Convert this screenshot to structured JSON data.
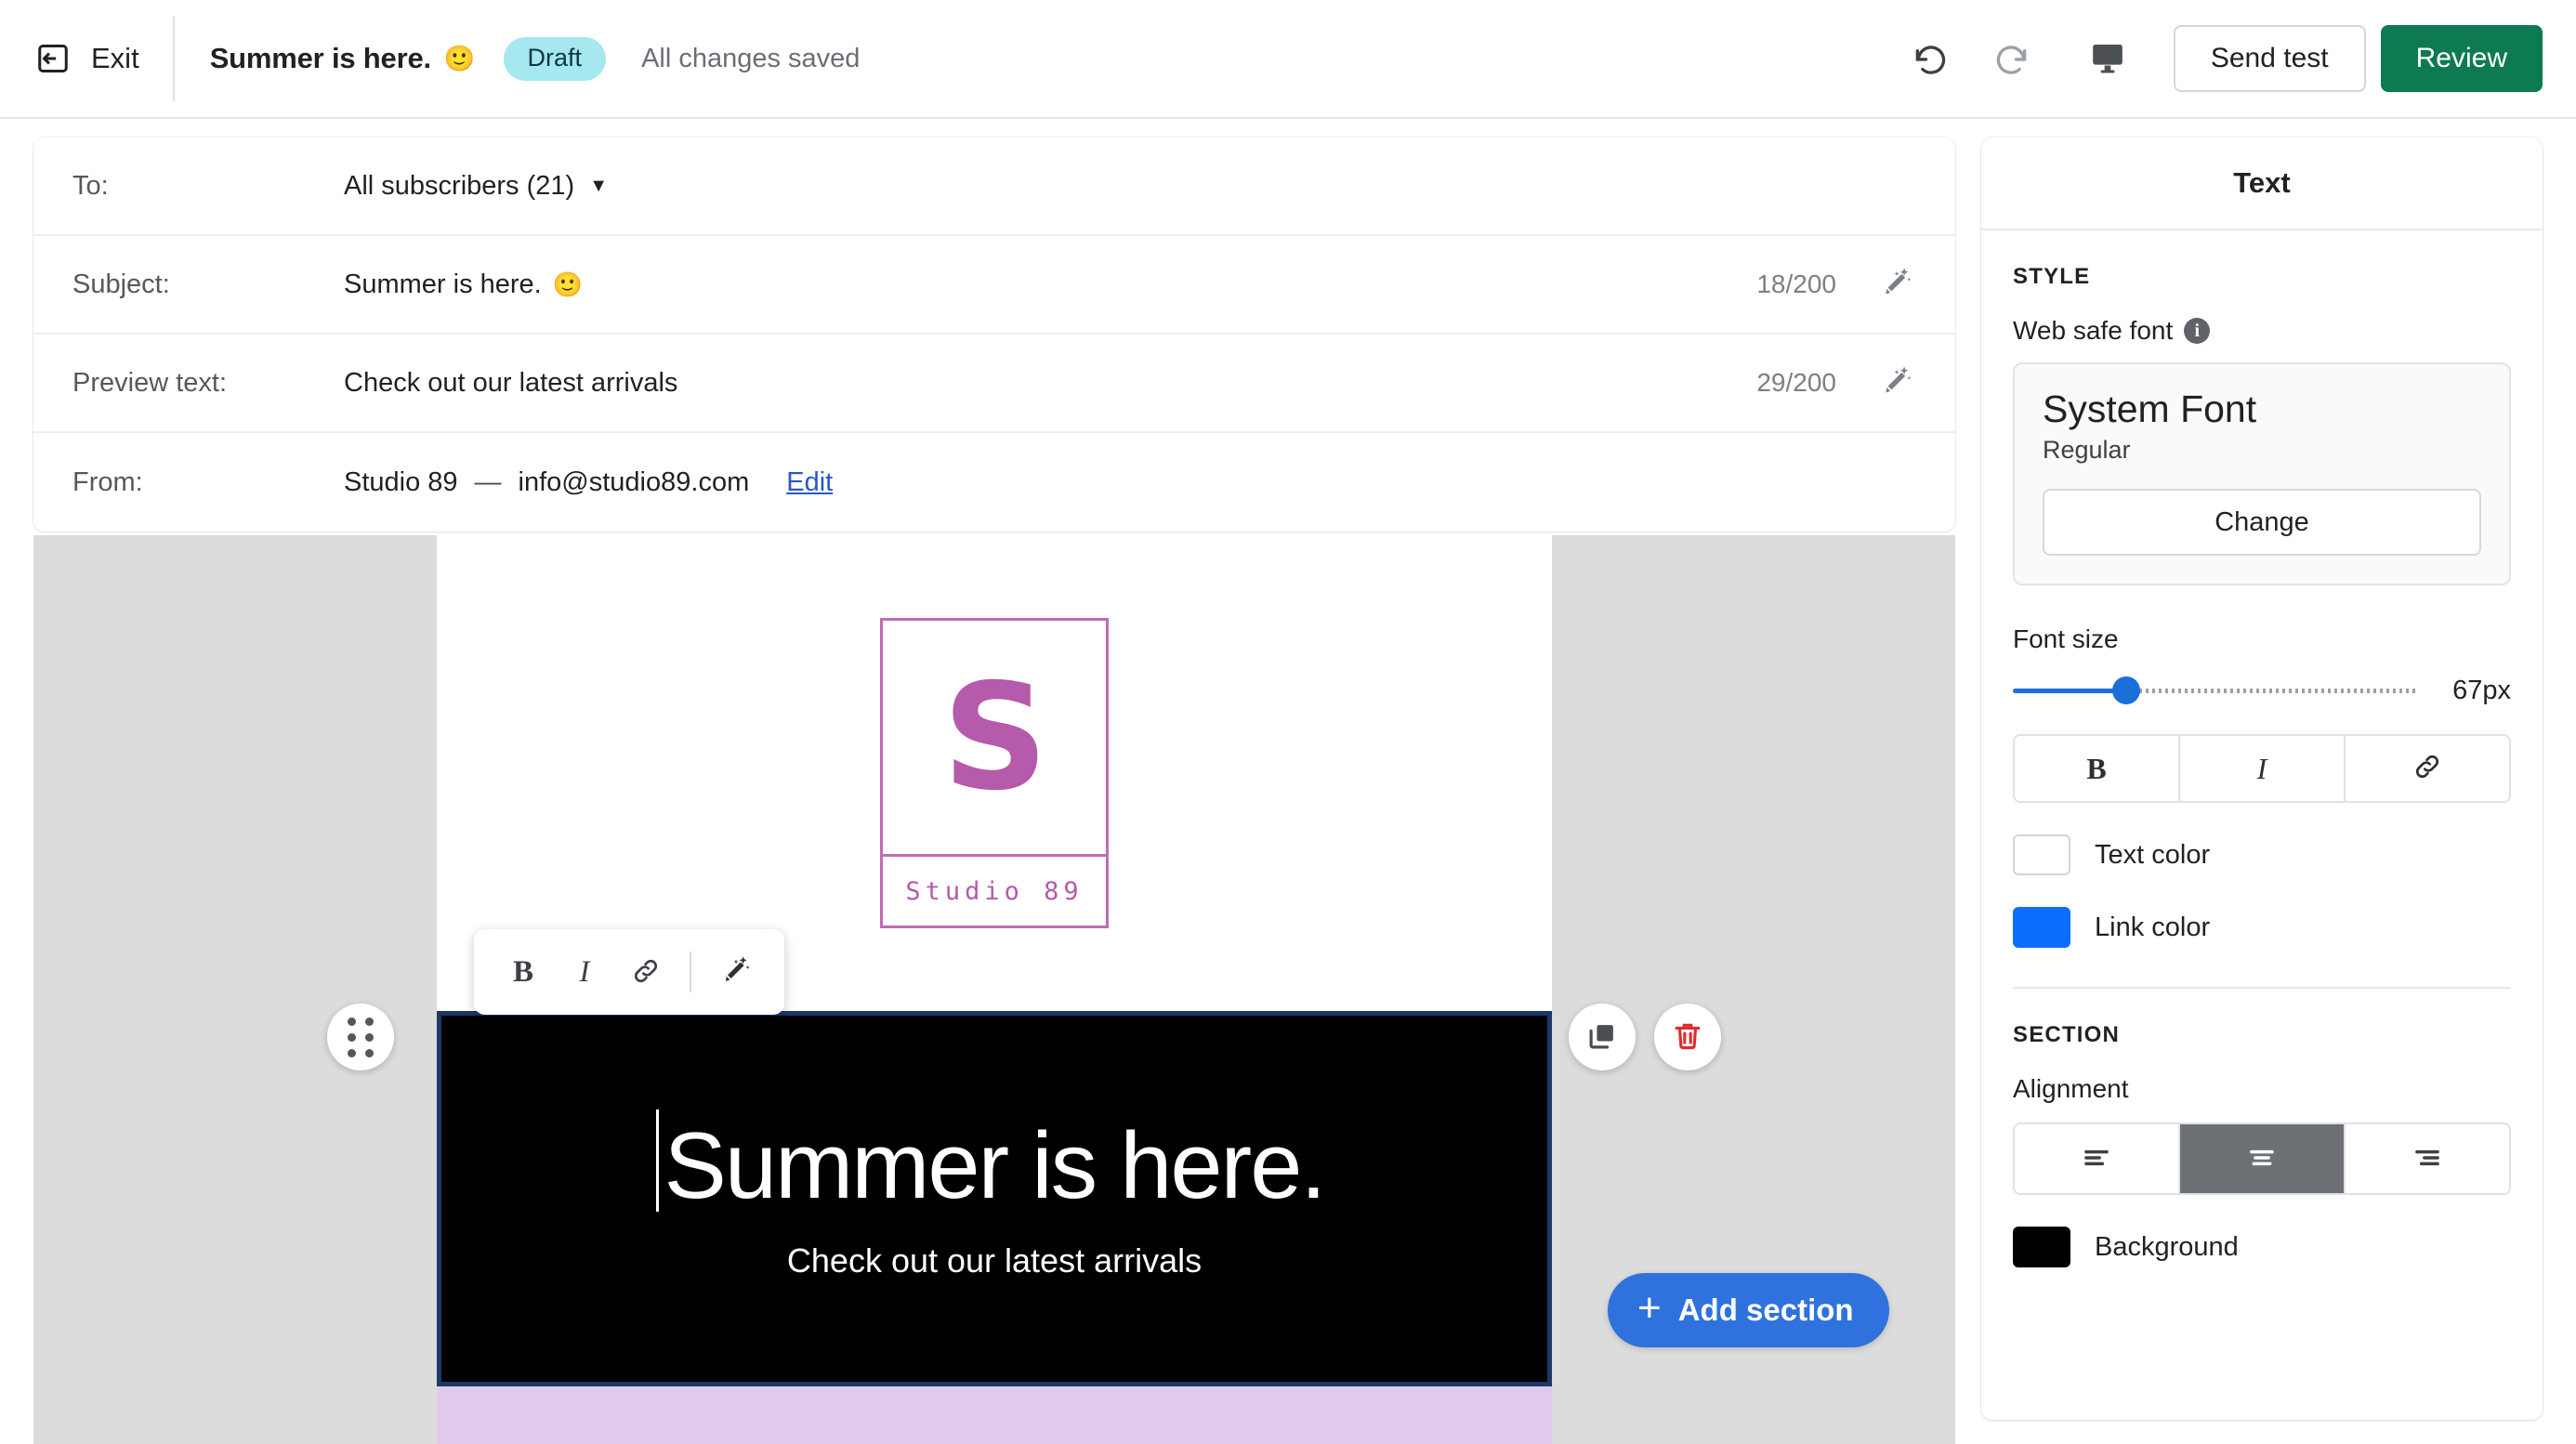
{
  "topbar": {
    "exit_label": "Exit",
    "exit_icon": "exit-arrow-icon",
    "campaign_title": "Summer is here.",
    "campaign_emoji": "🙂",
    "status_badge": "Draft",
    "status_badge_color": "#a5e8ef",
    "save_status": "All changes saved",
    "undo_icon": "undo-icon",
    "redo_icon": "redo-icon",
    "preview_icon": "desktop-preview-icon",
    "send_test_label": "Send test",
    "review_label": "Review",
    "review_color": "#0d7a52"
  },
  "header_fields": {
    "rows": [
      {
        "label": "To:",
        "value": "All subscribers (21)",
        "has_caret": true
      },
      {
        "label": "Subject:",
        "value": "Summer is here.",
        "emoji": "🙂",
        "counter": "18/200"
      },
      {
        "label": "Preview text:",
        "value": "Check out our latest arrivals",
        "counter": "29/200"
      },
      {
        "label": "From:",
        "value": "Studio 89",
        "dash": "—",
        "email": "info@studio89.com",
        "edit_label": "Edit"
      }
    ],
    "wand_icon": "magic-wand-edit-icon"
  },
  "canvas": {
    "logo": {
      "monogram": "S",
      "name": "Studio 89",
      "color": "#b65aab"
    },
    "float_toolbar": {
      "bold_label": "B",
      "italic_label": "I",
      "link_icon": "link-icon",
      "ai_icon": "magic-wand-edit-icon"
    },
    "hero": {
      "heading": "Summer is here.",
      "subheading": "Check out our latest arrivals",
      "background": "#000000",
      "selection_border": "#1b3866"
    },
    "next_section_color": "#e0c9ec",
    "drag_handle_icon": "drag-dots-icon",
    "duplicate_icon": "duplicate-icon",
    "delete_icon": "trash-icon",
    "delete_icon_color": "#e02d2d",
    "add_section_label": "Add section",
    "add_section_color": "#2f72de"
  },
  "panel": {
    "title": "Text",
    "style_section": {
      "heading": "STYLE",
      "web_safe_font_label": "Web safe font",
      "info_icon": "info-icon",
      "font_name": "System Font",
      "font_weight": "Regular",
      "change_label": "Change",
      "font_size_label": "Font size",
      "font_size_value": "67px",
      "font_size_percent": 28,
      "bold_label": "B",
      "italic_label": "I",
      "link_icon": "link-icon",
      "text_color_label": "Text color",
      "text_color_value": "#ffffff",
      "link_color_label": "Link color",
      "link_color_value": "#0d6efd"
    },
    "section_section": {
      "heading": "SECTION",
      "alignment_label": "Alignment",
      "alignment_options": [
        "align-left",
        "align-center",
        "align-right"
      ],
      "alignment_selected": "align-center",
      "background_label": "Background",
      "background_value": "#000000"
    }
  }
}
